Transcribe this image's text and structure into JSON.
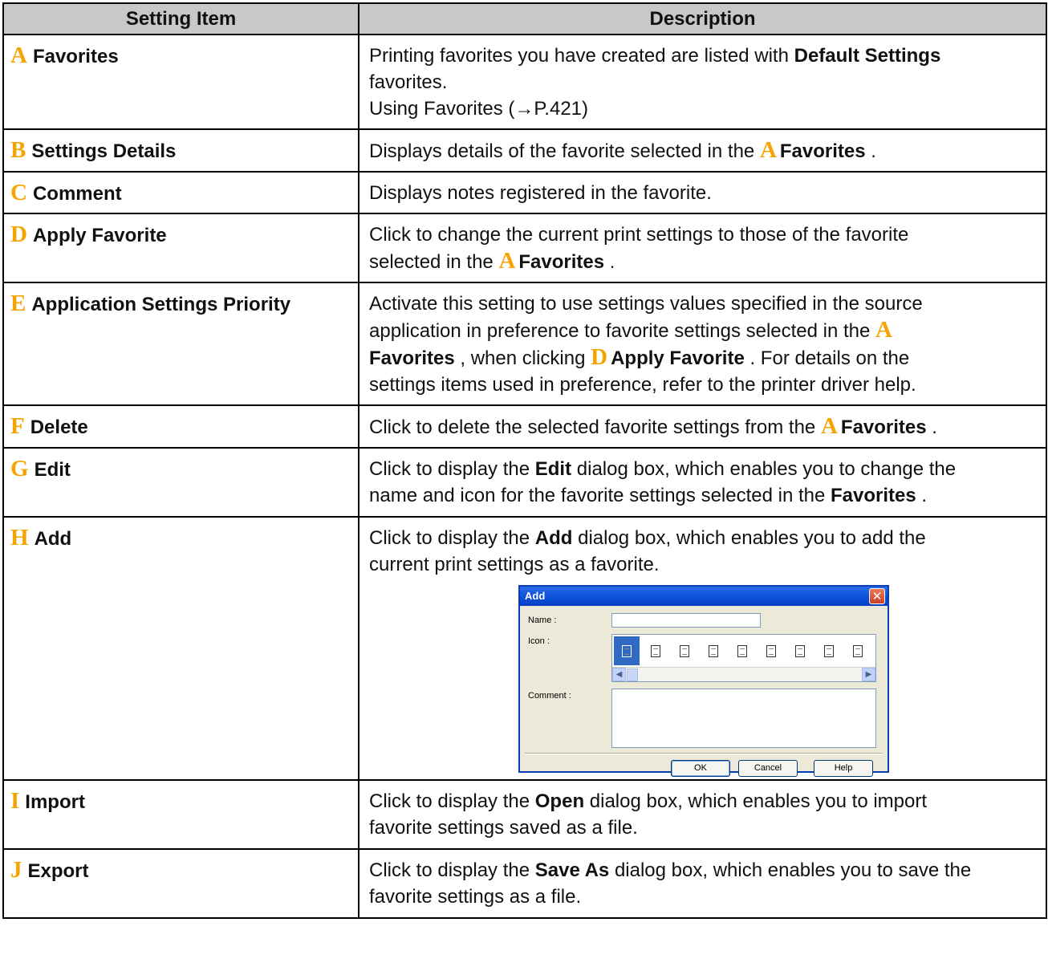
{
  "header": {
    "col1": "Setting Item",
    "col2": "Description"
  },
  "rows": [
    {
      "letter": "A",
      "name": "Favorites",
      "d1": "Printing favorites you have created are listed with ",
      "d1b": "Default Settings",
      "d2": "favorites.",
      "d3": "Using Favorites (→P.421)"
    },
    {
      "letter": "B",
      "name": "Settings Details",
      "d1": "Displays details of the favorite selected in the ",
      "ref_letter": "A",
      "ref_name": "Favorites",
      "d2": "."
    },
    {
      "letter": "C",
      "name": "Comment",
      "d1": "Displays notes registered in the favorite."
    },
    {
      "letter": "D",
      "name": "Apply Favorite",
      "d1": "Click to change the current print settings to those of the favorite",
      "d2": "selected in the ",
      "ref_letter": "A",
      "ref_name": "Favorites",
      "d3": "."
    },
    {
      "letter": "E",
      "name": "Application Settings Priority",
      "d1": "Activate this setting to use settings values specified in the source",
      "d2": "application in preference to favorite settings selected in the ",
      "ref_letter": "A",
      "ref_name": "Favorites",
      "d3": ", when clicking ",
      "ref2_letter": "D",
      "ref2_name": "Apply Favorite",
      "d4": ". For details on the",
      "d5": "settings items used in preference, refer to the printer driver help."
    },
    {
      "letter": "F",
      "name": "Delete",
      "d1": "Click to delete the selected favorite settings from the ",
      "ref_letter": "A",
      "ref_name": "Favorites",
      "d2": "."
    },
    {
      "letter": "G",
      "name": "Edit",
      "d1": "Click to display the ",
      "d1b": "Edit",
      "d2": " dialog box, which enables you to change the",
      "d3": "name and icon for the favorite settings selected in the ",
      "d3b": "Favorites",
      "d4": "."
    },
    {
      "letter": "H",
      "name": "Add",
      "d1": "Click to display the ",
      "d1b": "Add",
      "d2": " dialog box, which enables you to add the",
      "d3": "current print settings as a favorite."
    },
    {
      "letter": "I",
      "name": "Import",
      "d1": "Click to display the ",
      "d1b": "Open",
      "d2": " dialog box, which enables you to import",
      "d3": "favorite settings saved as a file."
    },
    {
      "letter": "J",
      "name": "Export",
      "d1": "Click to display the ",
      "d1b": "Save As",
      "d2": " dialog box, which enables you to save the",
      "d3": "favorite settings as a file."
    }
  ],
  "dialog": {
    "title": "Add",
    "close_icon": "close-icon",
    "name_label": "Name :",
    "icon_label": "Icon :",
    "comment_label": "Comment :",
    "name_value": "",
    "comment_value": "",
    "ok": "OK",
    "cancel": "Cancel",
    "help": "Help",
    "icons": [
      "page-icon",
      "page-icon",
      "page-icon",
      "page-icon",
      "page-icon",
      "page-icon",
      "page-icon",
      "a4-icon",
      "page-icon"
    ]
  }
}
